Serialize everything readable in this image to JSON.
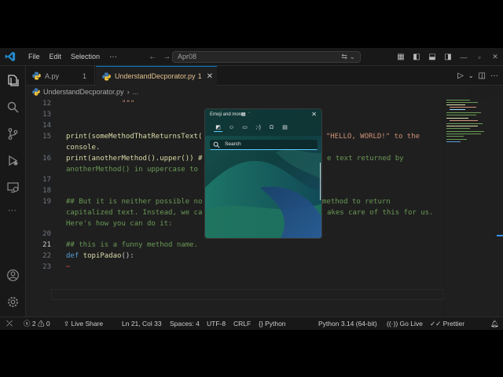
{
  "menu": {
    "file": "File",
    "edit": "Edit",
    "selection": "Selection",
    "more": "···"
  },
  "command_center": {
    "text": "Apr08"
  },
  "tabs": [
    {
      "label": "A.py",
      "badge": "1"
    },
    {
      "label": "UnderstandDecporator.py",
      "badge": "1",
      "close": "✕"
    }
  ],
  "breadcrumb": {
    "file": "UnderstandDecporator.py",
    "sep": "›",
    "more": "..."
  },
  "editor": {
    "line_numbers": [
      "12",
      "13",
      "14",
      "15",
      "",
      "16",
      "",
      "17",
      "18",
      "19",
      "",
      "",
      "20",
      "21",
      "22",
      "23"
    ],
    "lines": {
      "l12": "\"\"\"",
      "l15a_fn": "print(someMethodThatReturnsText(",
      "l15a_str": "t \"HELLO, WORLD!\" to the",
      "l15b": "console.",
      "l16a_fn": "print(anotherMethod().upper()) #",
      "l16a_tail": "e text returned by",
      "l16b": "anotherMethod() in uppercase to",
      "l19a_head": "## But it is neither possible no",
      "l19a_tail": "method to return",
      "l19b_head": "capitalized text. Instead, we ca",
      "l19b_tail": "akes care of this for us.",
      "l19c": "Here's how you can do it:",
      "l21": "## this is a funny method name.",
      "l22_kw": "def",
      "l22_fn": "topiPadao",
      "l22_rest": "():",
      "l23": "~"
    }
  },
  "emoji_panel": {
    "title": "Emoji and more",
    "search_placeholder": "Search",
    "close": "✕"
  },
  "status": {
    "errors": "2",
    "warnings": "0",
    "live_share": "Live Share",
    "position": "Ln 21, Col 33",
    "spaces": "Spaces: 4",
    "encoding": "UTF-8",
    "eol": "CRLF",
    "language": "Python",
    "interpreter": "Python 3.14 (64-bit)",
    "go_live": "Go Live",
    "prettier": "Prettier"
  },
  "colors": {
    "accent": "#0078d4",
    "tab_modified": "#e2c08d",
    "function": "#dcdcaa",
    "string": "#ce9178",
    "keyword": "#569cd6",
    "comment": "#6a9955"
  }
}
